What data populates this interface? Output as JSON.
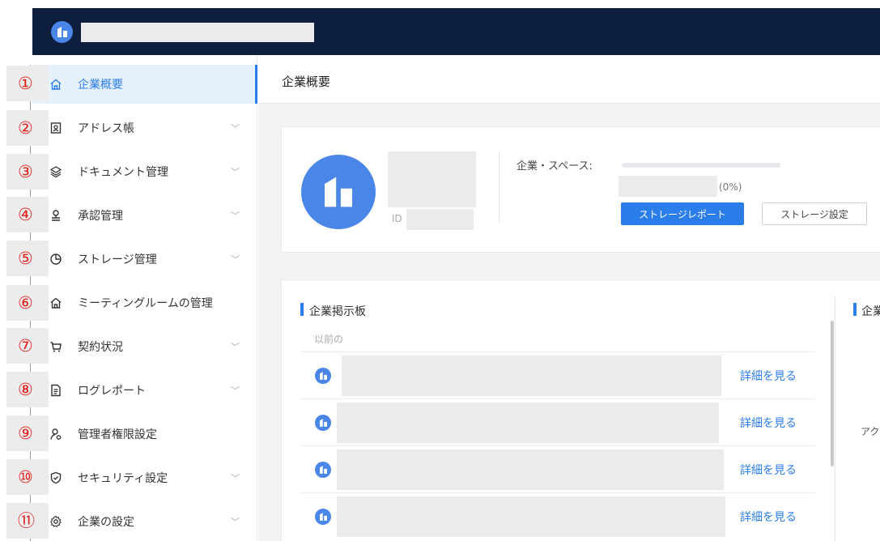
{
  "colors": {
    "topbar": "#0e1f3d",
    "accent": "#2b7de9",
    "logo": "#4a86e8",
    "annotation": "#e0201b",
    "mask": "#ebebeb"
  },
  "sidebar": {
    "items": [
      {
        "badge": "①",
        "icon": "home-icon",
        "label": "企業概要",
        "active": true,
        "chevron": false
      },
      {
        "badge": "②",
        "icon": "address-book-icon",
        "label": "アドレス帳",
        "active": false,
        "chevron": true
      },
      {
        "badge": "③",
        "icon": "layers-icon",
        "label": "ドキュメント管理",
        "active": false,
        "chevron": true
      },
      {
        "badge": "④",
        "icon": "user-stamp-icon",
        "label": "承認管理",
        "active": false,
        "chevron": true
      },
      {
        "badge": "⑤",
        "icon": "pie-chart-icon",
        "label": "ストレージ管理",
        "active": false,
        "chevron": true
      },
      {
        "badge": "⑥",
        "icon": "home-icon",
        "label": "ミーティングルームの管理",
        "active": false,
        "chevron": false
      },
      {
        "badge": "⑦",
        "icon": "cart-icon",
        "label": "契約状況",
        "active": false,
        "chevron": true
      },
      {
        "badge": "⑧",
        "icon": "document-icon",
        "label": "ログレポート",
        "active": false,
        "chevron": true
      },
      {
        "badge": "⑨",
        "icon": "admin-user-icon",
        "label": "管理者権限設定",
        "active": false,
        "chevron": false
      },
      {
        "badge": "⑩",
        "icon": "shield-check-icon",
        "label": "セキュリティ設定",
        "active": false,
        "chevron": true
      },
      {
        "badge": "⑪",
        "icon": "gear-icon",
        "label": "企業の設定",
        "active": false,
        "chevron": true
      }
    ]
  },
  "main": {
    "page_title": "企業概要",
    "company": {
      "id_label": "ID",
      "space_label": "企業・スペース:",
      "space_percent": "(0%)",
      "storage_percent": 0,
      "report_button": "ストレージレポート",
      "settings_button": "ストレージ設定"
    },
    "board": {
      "title": "企業掲示板",
      "subtitle": "以前の",
      "rows": [
        {
          "link": "詳細を見る"
        },
        {
          "link": "詳細を見る"
        },
        {
          "link": "詳細を見る"
        },
        {
          "link": "詳細を見る"
        }
      ]
    },
    "board2": {
      "title": "企業",
      "text": "アク"
    }
  }
}
